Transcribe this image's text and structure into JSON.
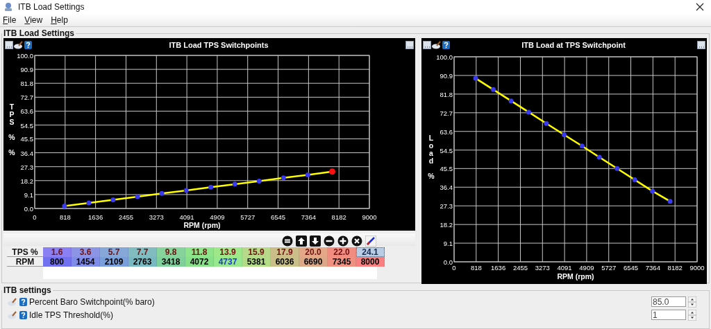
{
  "window": {
    "title": "ITB Load Settings"
  },
  "menu": [
    {
      "label": "File"
    },
    {
      "label": "View"
    },
    {
      "label": "Help"
    }
  ],
  "panel": {
    "title": "ITB Load Settings"
  },
  "charts": [
    {
      "title": "ITB Load TPS Switchpoints",
      "chart_data": {
        "type": "line",
        "xlabel": "RPM (rpm)",
        "ylabel": "TPS % %",
        "x": [
          800,
          1454,
          2109,
          2763,
          3418,
          4072,
          4737,
          5381,
          6036,
          6690,
          7345,
          8000
        ],
        "grid": true,
        "series": [
          {
            "color": "#ffff00",
            "marker": "circle",
            "values": [
              1.6,
              3.6,
              5.7,
              7.7,
              9.8,
              11.8,
              13.9,
              15.9,
              17.9,
              20.0,
              22.0,
              24.1
            ]
          }
        ],
        "xlim": [
          0,
          9000
        ],
        "ylim": [
          0,
          100
        ],
        "xticks": [
          0,
          818,
          1636,
          2455,
          3273,
          4091,
          4909,
          5727,
          6545,
          7364,
          8182,
          9000
        ],
        "yticks": [
          {
            "value": 0,
            "label": "0.0"
          },
          {
            "value": 9.1,
            "label": "9.1"
          },
          {
            "value": 18.2,
            "label": "18.2"
          },
          {
            "value": 27.3,
            "label": "27.3"
          },
          {
            "value": 36.4,
            "label": "36.4"
          },
          {
            "value": 45.5,
            "label": "45.5"
          },
          {
            "value": 54.5,
            "label": "54.5"
          },
          {
            "value": 63.6,
            "label": "63.6"
          },
          {
            "value": 72.7,
            "label": "72.7"
          },
          {
            "value": 81.8,
            "label": "81.8"
          },
          {
            "value": 90.9,
            "label": "90.9"
          },
          {
            "value": 100,
            "label": "100.0"
          }
        ]
      }
    },
    {
      "title": "ITB Load at TPS Switchpoint",
      "chart_data": {
        "type": "line",
        "xlabel": "RPM (rpm)",
        "ylabel": "Load %",
        "x": [
          800,
          1454,
          2109,
          2763,
          3418,
          4072,
          4737,
          5381,
          6036,
          6690,
          7345,
          8000
        ],
        "grid": true,
        "series": [
          {
            "color": "#ffff00",
            "marker": "circle",
            "values": [
              89.5,
              84.0,
              78.5,
              73.0,
              67.5,
              62.0,
              56.5,
              51.0,
              45.5,
              40.0,
              34.5,
              29.5
            ]
          }
        ],
        "xlim": [
          0,
          9000
        ],
        "ylim": [
          0,
          100
        ],
        "xticks": [
          0,
          818,
          1636,
          2455,
          3273,
          4091,
          4909,
          5727,
          6545,
          7364,
          8182,
          9000
        ],
        "yticks": [
          {
            "value": 0,
            "label": "0.0"
          },
          {
            "value": 9.1,
            "label": "9.1"
          },
          {
            "value": 18.2,
            "label": "18.2"
          },
          {
            "value": 27.3,
            "label": "27.3"
          },
          {
            "value": 36.4,
            "label": "36.4"
          },
          {
            "value": 45.5,
            "label": "45.5"
          },
          {
            "value": 54.5,
            "label": "54.5"
          },
          {
            "value": 63.6,
            "label": "63.6"
          },
          {
            "value": 72.7,
            "label": "72.7"
          },
          {
            "value": 81.8,
            "label": "81.8"
          },
          {
            "value": 90.9,
            "label": "90.9"
          },
          {
            "value": 100,
            "label": "100.0"
          }
        ]
      }
    }
  ],
  "table": {
    "rows": [
      {
        "label": "TPS %",
        "cells": [
          {
            "value": "1.6",
            "color": "#8a80f4",
            "highlighted": false,
            "selected": false
          },
          {
            "value": "3.6",
            "color": "#8c94e6",
            "highlighted": false,
            "selected": false
          },
          {
            "value": "5.7",
            "color": "#86a8d8",
            "highlighted": false,
            "selected": false
          },
          {
            "value": "7.7",
            "color": "#80bcc0",
            "highlighted": false,
            "selected": false
          },
          {
            "value": "9.8",
            "color": "#86d49c",
            "highlighted": false,
            "selected": false
          },
          {
            "value": "11.8",
            "color": "#8ee48a",
            "highlighted": false,
            "selected": false
          },
          {
            "value": "13.9",
            "color": "#9ee88a",
            "highlighted": false,
            "selected": false
          },
          {
            "value": "15.9",
            "color": "#b8d88a",
            "highlighted": false,
            "selected": false
          },
          {
            "value": "17.9",
            "color": "#ccbe88",
            "highlighted": false,
            "selected": false
          },
          {
            "value": "20.0",
            "color": "#e4a888",
            "highlighted": false,
            "selected": false
          },
          {
            "value": "22.0",
            "color": "#f08c80",
            "highlighted": false,
            "selected": false
          },
          {
            "value": "24.1",
            "color": "#b9cde5",
            "highlighted": false,
            "selected": true
          }
        ]
      },
      {
        "label": "RPM",
        "cells": [
          {
            "value": "800",
            "color": "#7272f0",
            "highlighted": false
          },
          {
            "value": "1454",
            "color": "#7f8ce8",
            "highlighted": false
          },
          {
            "value": "2109",
            "color": "#7aa0dc",
            "highlighted": false
          },
          {
            "value": "2763",
            "color": "#78b8c0",
            "highlighted": false
          },
          {
            "value": "3418",
            "color": "#80d09c",
            "highlighted": false
          },
          {
            "value": "4072",
            "color": "#88e088",
            "highlighted": false
          },
          {
            "value": "4737",
            "color": "#98e890",
            "highlighted": true
          },
          {
            "value": "5381",
            "color": "#b4dc88",
            "highlighted": false
          },
          {
            "value": "6036",
            "color": "#c8c088",
            "highlighted": false
          },
          {
            "value": "6690",
            "color": "#dca888",
            "highlighted": false
          },
          {
            "value": "7345",
            "color": "#f09080",
            "highlighted": false
          },
          {
            "value": "8000",
            "color": "#f88080",
            "highlighted": false
          }
        ]
      }
    ]
  },
  "settings": {
    "title": "ITB settings",
    "items": [
      {
        "label": "Percent Baro Switchpoint(% baro)",
        "value": "85.0"
      },
      {
        "label": "Idle TPS Threshold(%)",
        "value": "1"
      }
    ]
  }
}
